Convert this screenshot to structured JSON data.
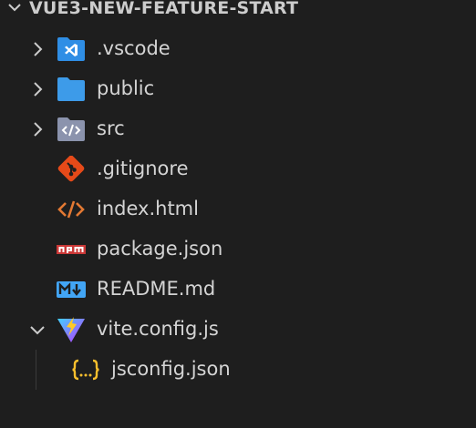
{
  "explorer": {
    "title": "VUE3-NEW-FEATURE-START",
    "items": [
      {
        "label": ".vscode",
        "kind": "folder",
        "expanded": false,
        "icon": "vscode-folder-icon",
        "icon_color": "#2f8ee5"
      },
      {
        "label": "public",
        "kind": "folder",
        "expanded": false,
        "icon": "folder-icon",
        "icon_color": "#3d9be9"
      },
      {
        "label": "src",
        "kind": "folder",
        "expanded": false,
        "icon": "src-folder-icon",
        "icon_color": "#8b93ad"
      },
      {
        "label": ".gitignore",
        "kind": "file",
        "icon": "git-icon",
        "icon_color": "#e64a19"
      },
      {
        "label": "index.html",
        "kind": "file",
        "icon": "html-code-icon",
        "icon_color": "#e37933"
      },
      {
        "label": "package.json",
        "kind": "file",
        "icon": "npm-icon",
        "icon_color": "#cb3837"
      },
      {
        "label": "README.md",
        "kind": "file",
        "icon": "markdown-icon",
        "icon_color": "#42a5f5"
      },
      {
        "label": "vite.config.js",
        "kind": "file",
        "expanded": true,
        "icon": "vite-icon",
        "icon_color": "#ffca28"
      },
      {
        "label": "jsconfig.json",
        "kind": "file",
        "nested": true,
        "icon": "json-braces-icon",
        "icon_color": "#fbc02d"
      }
    ]
  },
  "colors": {
    "background": "#1e1e1e",
    "text": "#d4d4d4",
    "header_text": "#cccccc"
  }
}
